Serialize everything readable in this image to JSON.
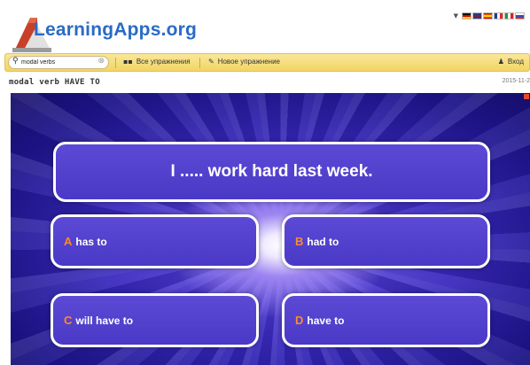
{
  "brand": {
    "logo_text": "LearningApps.org",
    "logo_icon": "building-blocks-logo"
  },
  "flags": [
    "de",
    "gb",
    "es",
    "fr",
    "it",
    "ru"
  ],
  "toolbar": {
    "search_value": "modal verbs",
    "search_icon": "magnifier-icon",
    "clear_icon": "clear-icon",
    "all_exercises_label": "Все упражнения",
    "new_exercise_label": "Новое упражнение",
    "login_label": "Вход"
  },
  "page": {
    "title": "modal verb HAVE TO",
    "date": "2015-11-2"
  },
  "quiz": {
    "question": "I ..... work hard last week.",
    "answers": [
      {
        "letter": "A",
        "text": "has to"
      },
      {
        "letter": "B",
        "text": "had to"
      },
      {
        "letter": "C",
        "text": "will have to"
      },
      {
        "letter": "D",
        "text": "have to"
      }
    ]
  },
  "colors": {
    "brand_blue": "#2a6bc4",
    "toolbar_yellow": "#f2d565",
    "answer_letter": "#ff8a2a",
    "card_purple": "#4a39c6"
  }
}
